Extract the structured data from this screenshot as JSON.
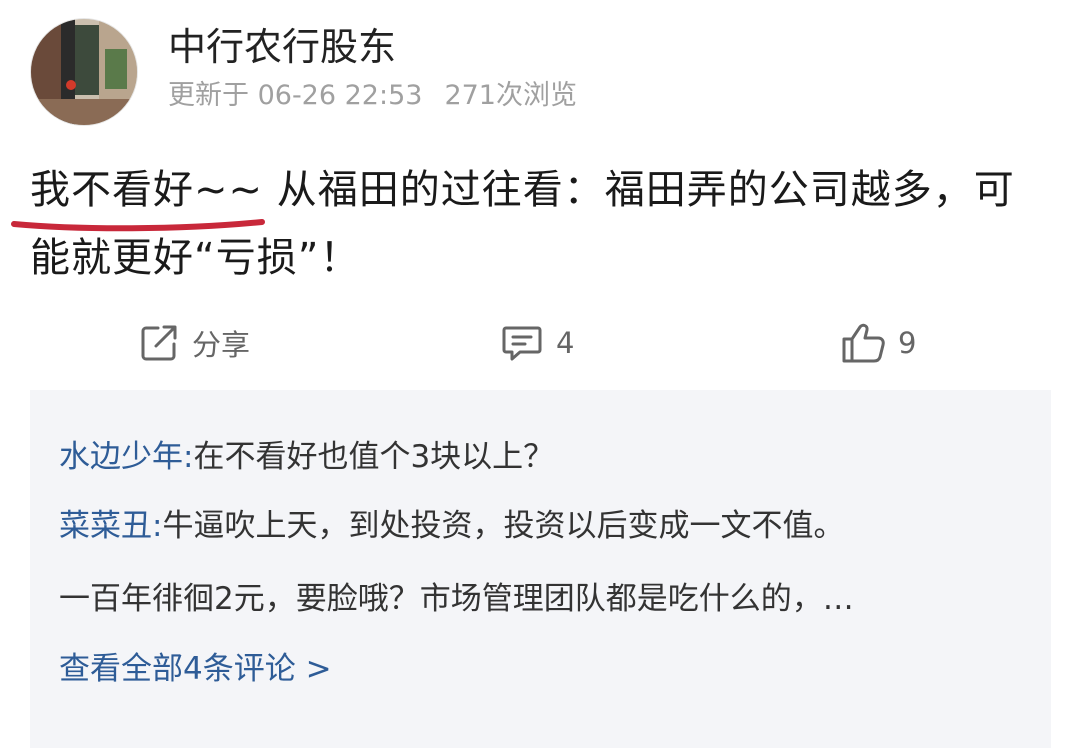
{
  "post": {
    "author": "中行农行股东",
    "meta": {
      "updated": "更新于 06-26 22:53",
      "views": "271次浏览"
    },
    "content": "我不看好~~ 从福田的过往看：福田弄的公司越多，可能就更好“亏损”！"
  },
  "actions": {
    "share_label": "分享",
    "comment_count": "4",
    "like_count": "9"
  },
  "comments": {
    "items": [
      {
        "user": "水边少年",
        "sep": ":",
        "text": "在不看好也值个3块以上？"
      },
      {
        "user": "菜菜丑",
        "sep": ":",
        "text": "牛逼吹上天，到处投资，投资以后变成一文不值。"
      }
    ],
    "continuation": "一百年徘徊2元，要脸哦？市场管理团队都是吃什么的，…",
    "view_all": "查看全部4条评论 >"
  },
  "icons": [
    "avatar-photo",
    "share-icon",
    "comment-icon",
    "thumbs-up-icon"
  ],
  "colors": {
    "link_blue": "#2e5c97",
    "meta_gray": "#a0a0a0",
    "comment_bg": "#f4f5f8",
    "underline_red": "#c8283a"
  }
}
